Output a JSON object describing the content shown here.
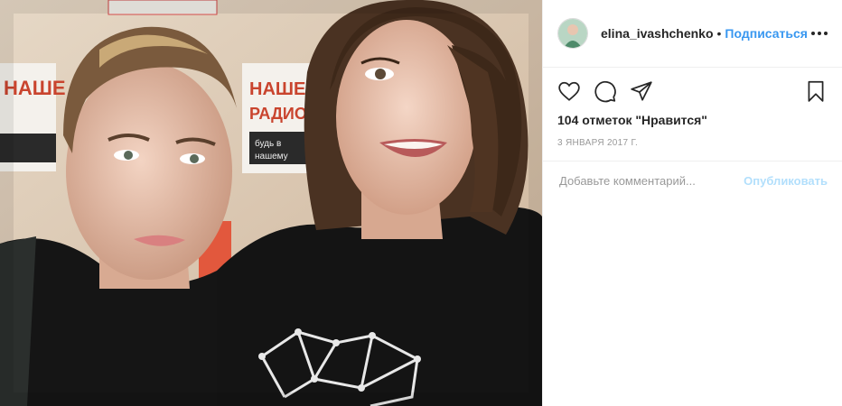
{
  "post": {
    "username": "elina_ivashchenko",
    "separator": "•",
    "follow_label": "Подписаться",
    "likes_text": "104 отметок \"Нравится\"",
    "date": "3 ЯНВАРЯ 2017 Г.",
    "comment_placeholder": "Добавьте комментарий...",
    "publish_label": "Опубликовать"
  },
  "icons": {
    "like": "heart-icon",
    "comment": "comment-icon",
    "share": "share-icon",
    "save": "bookmark-icon",
    "more": "more-options-icon"
  },
  "photo": {
    "sign_text_1": "НАШЕ",
    "sign_text_2": "РАДИО",
    "sign_text_3": "будь в",
    "sign_text_4": "нашему"
  },
  "colors": {
    "link": "#3897f0",
    "publish_disabled": "#b2dffc",
    "text": "#262626",
    "muted": "#999999"
  }
}
